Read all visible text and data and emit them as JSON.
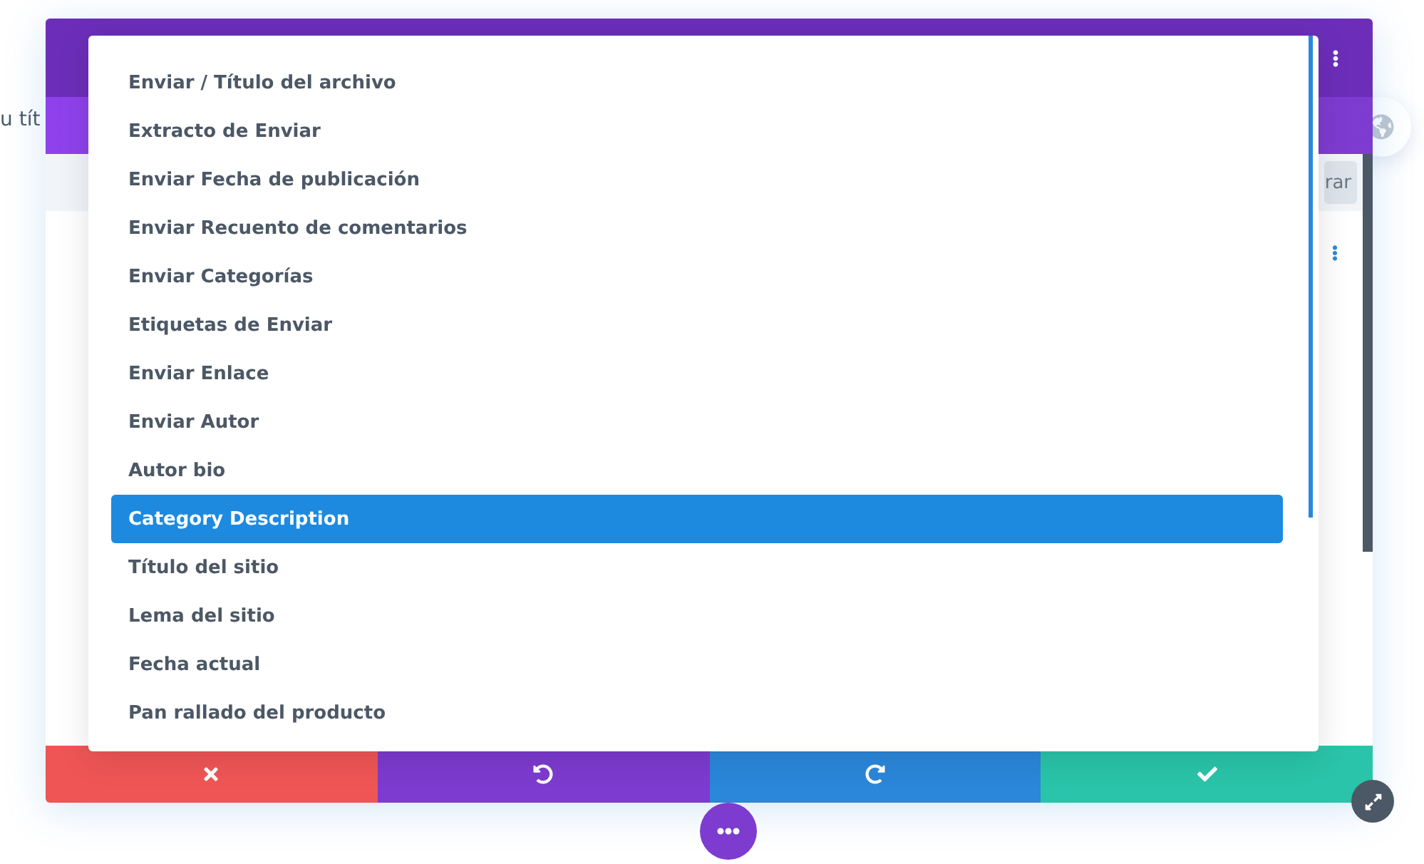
{
  "background_text": "u tít",
  "toolbar": {
    "button": "rar"
  },
  "dropdown": {
    "items": [
      {
        "label": "Enviar / Título del archivo",
        "selected": false
      },
      {
        "label": "Extracto de Enviar",
        "selected": false
      },
      {
        "label": "Enviar Fecha de publicación",
        "selected": false
      },
      {
        "label": "Enviar Recuento de comentarios",
        "selected": false
      },
      {
        "label": "Enviar Categorías",
        "selected": false
      },
      {
        "label": "Etiquetas de Enviar",
        "selected": false
      },
      {
        "label": "Enviar Enlace",
        "selected": false
      },
      {
        "label": "Enviar Autor",
        "selected": false
      },
      {
        "label": "Autor bio",
        "selected": false
      },
      {
        "label": "Category Description",
        "selected": true
      },
      {
        "label": "Título del sitio",
        "selected": false
      },
      {
        "label": "Lema del sitio",
        "selected": false
      },
      {
        "label": "Fecha actual",
        "selected": false
      },
      {
        "label": "Pan rallado del producto",
        "selected": false
      }
    ]
  },
  "footer": [
    {
      "kind": "cancel"
    },
    {
      "kind": "undo"
    },
    {
      "kind": "redo"
    },
    {
      "kind": "save"
    }
  ]
}
